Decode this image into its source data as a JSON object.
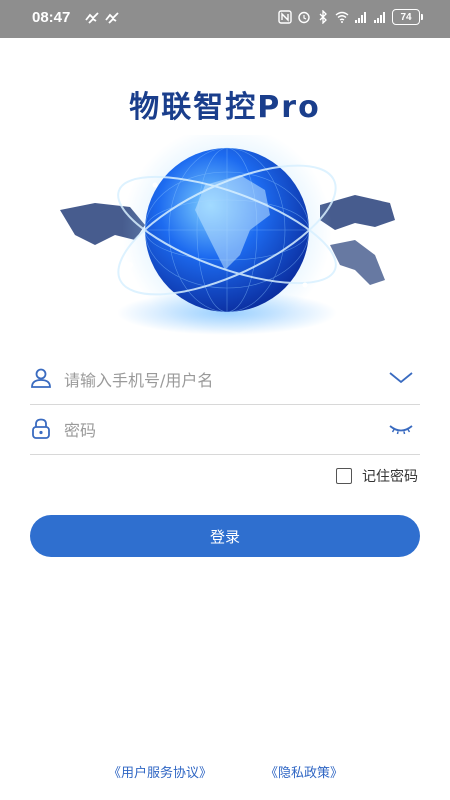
{
  "status_bar": {
    "time": "08:47",
    "battery": "74",
    "icons": [
      "app-badge-icon",
      "app-badge-icon",
      "nfc-icon",
      "alarm-icon",
      "bluetooth-icon",
      "wifi-icon",
      "signal-5g-icon",
      "signal-5g-icon",
      "battery-icon"
    ]
  },
  "app": {
    "title": "物联智控Pro"
  },
  "login": {
    "username_placeholder": "请输入手机号/用户名",
    "password_placeholder": "密码",
    "remember_label": "记住密码",
    "submit_label": "登录"
  },
  "footer": {
    "terms_link": "《用户服务协议》",
    "privacy_link": "《隐私政策》"
  },
  "colors": {
    "title": "#1a3e8c",
    "primary": "#2f6fcf",
    "link": "#2f66c4",
    "statusbar": "#8e8e8e"
  }
}
